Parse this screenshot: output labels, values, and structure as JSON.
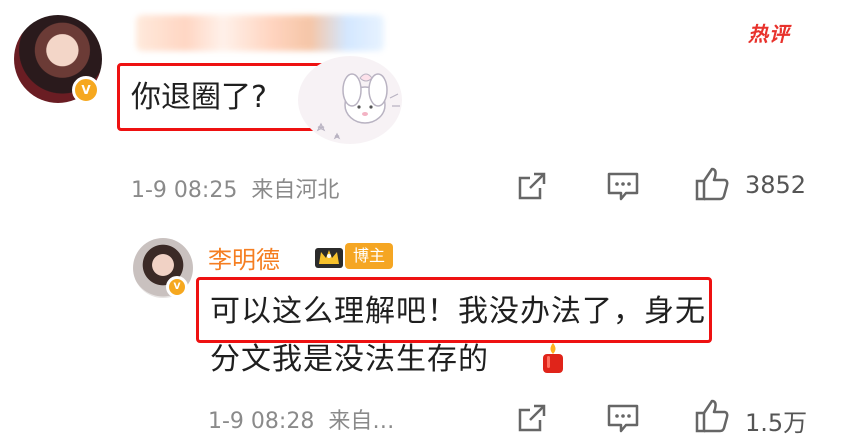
{
  "comment": {
    "hot_label": "热评",
    "text": "你退圈了?",
    "date": "1-9 08:25",
    "location": "来自河北",
    "like_count": "3852",
    "verified_badge": "V"
  },
  "reply": {
    "username": "李明德",
    "tag": "博主",
    "text_line1": "可以这么理解吧！我没办法了，身无",
    "text_line2": "分文我是没法生存的",
    "date": "1-9 08:28",
    "location": "来自…",
    "like_count": "1.5万",
    "verified_badge": "V"
  },
  "icons": [
    "share-icon",
    "comment-icon",
    "like-icon",
    "crown-icon",
    "candle-emoji-icon",
    "bunny-sticker-icon"
  ],
  "colors": {
    "highlight_box": "#ee1111",
    "username": "#f57e21",
    "hot_label": "#e8322c",
    "meta_text": "#8a8a8a",
    "verified": "#f6a81f"
  }
}
